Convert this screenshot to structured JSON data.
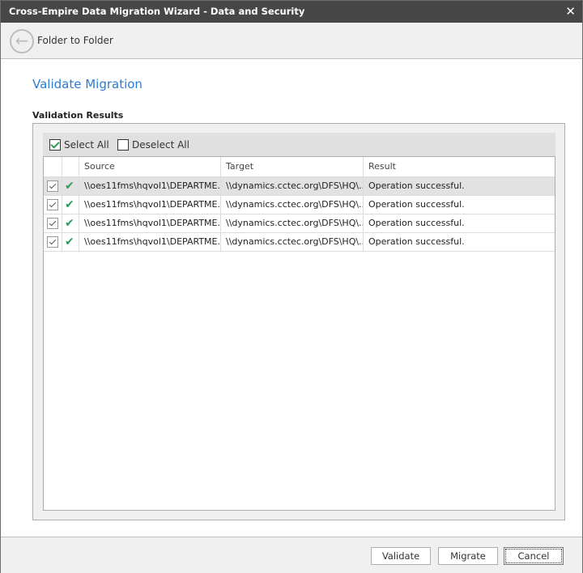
{
  "window": {
    "title": "Cross-Empire Data Migration Wizard  -  Data and Security"
  },
  "header": {
    "breadcrumb": "Folder to Folder"
  },
  "page": {
    "title": "Validate Migration",
    "section": "Validation Results"
  },
  "toolbar": {
    "select_all": "Select All",
    "deselect_all": "Deselect All"
  },
  "columns": [
    "",
    "",
    "Source",
    "Target",
    "Result"
  ],
  "rows": [
    {
      "checked": true,
      "source": "\\\\oes11fms\\hqvol1\\DEPARTME...",
      "target": "\\\\dynamics.cctec.org\\DFS\\HQ\\...",
      "result": "Operation successful."
    },
    {
      "checked": true,
      "source": "\\\\oes11fms\\hqvol1\\DEPARTME...",
      "target": "\\\\dynamics.cctec.org\\DFS\\HQ\\...",
      "result": "Operation successful."
    },
    {
      "checked": true,
      "source": "\\\\oes11fms\\hqvol1\\DEPARTME...",
      "target": "\\\\dynamics.cctec.org\\DFS\\HQ\\...",
      "result": "Operation successful."
    },
    {
      "checked": true,
      "source": "\\\\oes11fms\\hqvol1\\DEPARTME...",
      "target": "\\\\dynamics.cctec.org\\DFS\\HQ\\...",
      "result": "Operation successful."
    }
  ],
  "footer": {
    "validate": "Validate",
    "migrate": "Migrate",
    "cancel": "Cancel"
  }
}
